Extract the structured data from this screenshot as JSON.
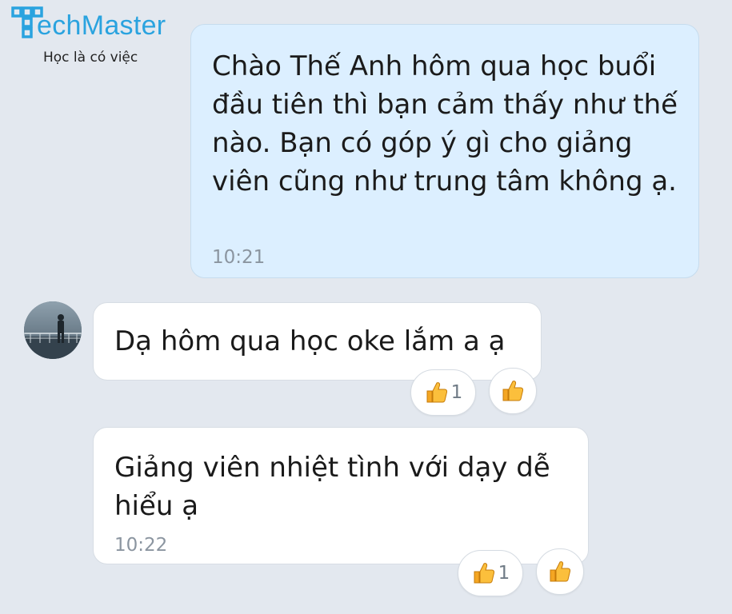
{
  "logo": {
    "brand": "echMaster",
    "tagline": "Học là có việc"
  },
  "messages": [
    {
      "direction": "sent",
      "text": "Chào Thế Anh hôm qua học buổi đầu tiên thì bạn cảm thấy như thế nào. Bạn có góp ý gì cho giảng viên cũng như trung tâm không ạ.",
      "time": "10:21"
    },
    {
      "direction": "received",
      "text": "Dạ hôm qua học oke lắm a ạ",
      "reaction": {
        "icon": "thumbs-up-icon",
        "count": "1"
      }
    },
    {
      "direction": "received",
      "text": "Giảng viên nhiệt tình với dạy dễ hiểu ạ",
      "time": "10:22",
      "reaction": {
        "icon": "thumbs-up-icon",
        "count": "1"
      }
    }
  ],
  "colors": {
    "background": "#e3e8ef",
    "sent_bubble": "#dcefff",
    "received_bubble": "#ffffff",
    "brand": "#2aa3df"
  }
}
